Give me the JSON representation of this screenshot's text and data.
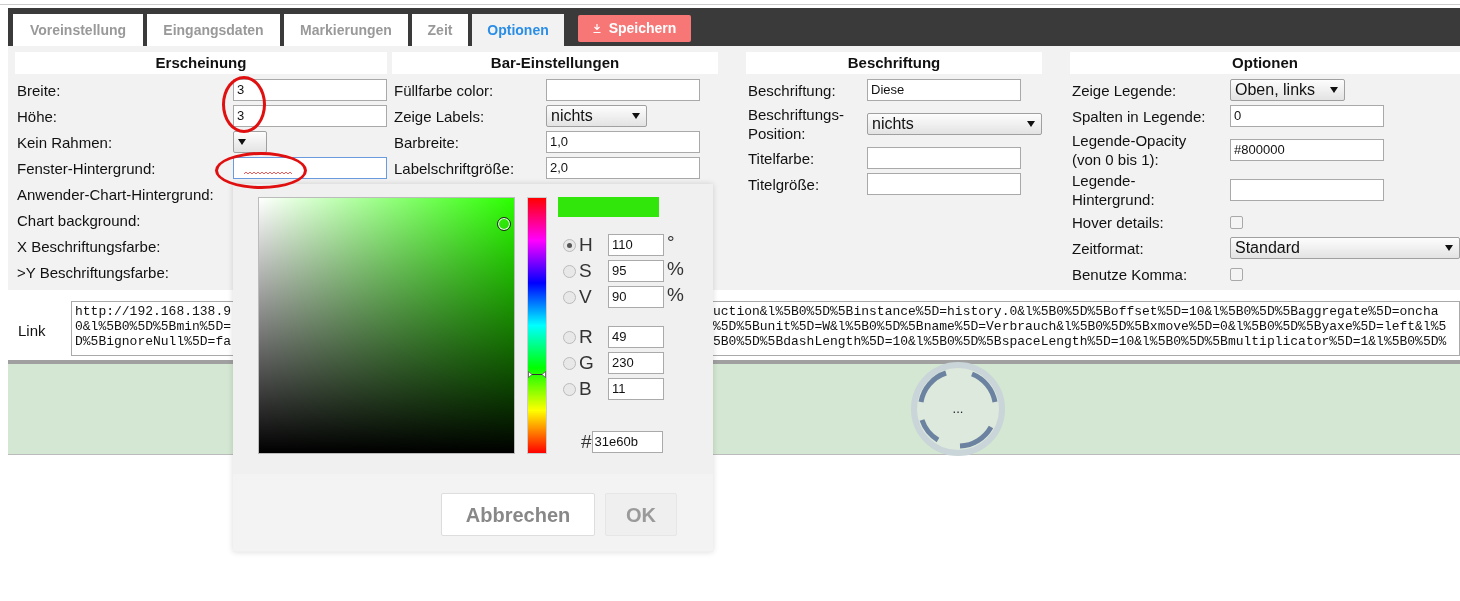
{
  "tabs": [
    {
      "label": "Voreinstellung",
      "selected": false
    },
    {
      "label": "Eingangsdaten",
      "selected": false
    },
    {
      "label": "Markierungen",
      "selected": false
    },
    {
      "label": "Zeit",
      "selected": false
    },
    {
      "label": "Optionen",
      "selected": true
    }
  ],
  "save_button": {
    "label": "Speichern"
  },
  "sections": [
    {
      "title": "Erscheinung",
      "rows": [
        {
          "label": "Breite:",
          "kind": "text",
          "value": "3",
          "focused": false
        },
        {
          "label": "Höhe:",
          "kind": "text",
          "value": "3",
          "focused": false
        },
        {
          "label": "Kein Rahmen:",
          "kind": "select",
          "value": ""
        },
        {
          "label": "Fenster-Hintergrund:",
          "kind": "text",
          "value": "",
          "focused": true
        },
        {
          "label": "Anwender-Chart-Hintergrund:",
          "kind": "label"
        },
        {
          "label": "Chart background:",
          "kind": "label"
        },
        {
          "label": "X Beschriftungsfarbe:",
          "kind": "label"
        },
        {
          "label": ">Y Beschriftungsfarbe:",
          "kind": "label"
        }
      ]
    },
    {
      "title": "Bar-Einstellungen",
      "rows": [
        {
          "label": "Füllfarbe color:",
          "kind": "text",
          "value": "",
          "focused": false
        },
        {
          "label": "Zeige Labels:",
          "kind": "select",
          "value": "nichts"
        },
        {
          "label": "Barbreite:",
          "kind": "text",
          "value": "1,0",
          "focused": false
        },
        {
          "label": "Labelschriftgröße:",
          "kind": "text",
          "value": "2,0",
          "focused": false
        }
      ]
    },
    {
      "title": "Beschriftung",
      "rows": [
        {
          "label": "Beschriftung:",
          "kind": "text",
          "value": "Diese",
          "focused": false
        },
        {
          "label": "Beschriftungs-Position:",
          "kind": "select",
          "value": "nichts"
        },
        {
          "label": "Titelfarbe:",
          "kind": "text",
          "value": "",
          "focused": false
        },
        {
          "label": "Titelgröße:",
          "kind": "text",
          "value": "",
          "focused": false
        }
      ]
    },
    {
      "title": "Optionen",
      "rows": [
        {
          "label": "Zeige Legende:",
          "kind": "select",
          "value": "Oben, links"
        },
        {
          "label": "Spalten in Legende:",
          "kind": "text",
          "value": "0",
          "focused": false
        },
        {
          "label": "Legende-Opacity (von 0 bis 1):",
          "kind": "text",
          "value": "#800000",
          "focused": false
        },
        {
          "label": "Legende-Hintergrund:",
          "kind": "text",
          "value": "",
          "focused": false
        },
        {
          "label": "Hover details:",
          "kind": "checkbox",
          "checked": false
        },
        {
          "label": "Zeitformat:",
          "kind": "select",
          "value": "Standard"
        },
        {
          "label": "Benutze Komma:",
          "kind": "checkbox",
          "checked": false
        }
      ]
    }
  ],
  "link": {
    "label": "Link",
    "lines": [
      {
        "start": "http://192.168.138.9",
        "end": "uction&l%5B0%5D%5Binstance%5D=history.0&l%5B0%5D%5Boffset%5D=10&l%5B0%5D%5Baggregate%5D=oncha"
      },
      {
        "start": "0&l%5B0%5D%5Bmin%5D=",
        "end": "%5D%5Bunit%5D=W&l%5B0%5D%5Bname%5D=Verbrauch&l%5B0%5D%5Bxmove%5D=0&l%5B0%5D%5Byaxe%5D=left&l%5"
      },
      {
        "start": "D%5BignoreNull%5D=fa",
        "end": "5B0%5D%5BdashLength%5D=10&l%5B0%5D%5BspaceLength%5D=10&l%5B0%5D%5Bmultiplicator%5D=1&l%5B0%5D%"
      }
    ]
  },
  "loading": {
    "text": "..."
  },
  "color_picker": {
    "color": "#31e60b",
    "hue_slider": {
      "level": 0.31
    },
    "channels": [
      {
        "label": "H",
        "value": "110",
        "unit": "°",
        "selected": true
      },
      {
        "label": "S",
        "value": "95",
        "unit": "%",
        "selected": false
      },
      {
        "label": "V",
        "value": "90",
        "unit": "%",
        "selected": false
      },
      {
        "label": "R",
        "value": "49",
        "selected": false
      },
      {
        "label": "G",
        "value": "230",
        "selected": false
      },
      {
        "label": "B",
        "value": "11",
        "selected": false
      }
    ],
    "hex": {
      "prefix": "#",
      "value": "31e60b"
    },
    "buttons": [
      {
        "label": "Abbrechen",
        "disabled": false
      },
      {
        "label": "OK",
        "disabled": true
      }
    ]
  }
}
